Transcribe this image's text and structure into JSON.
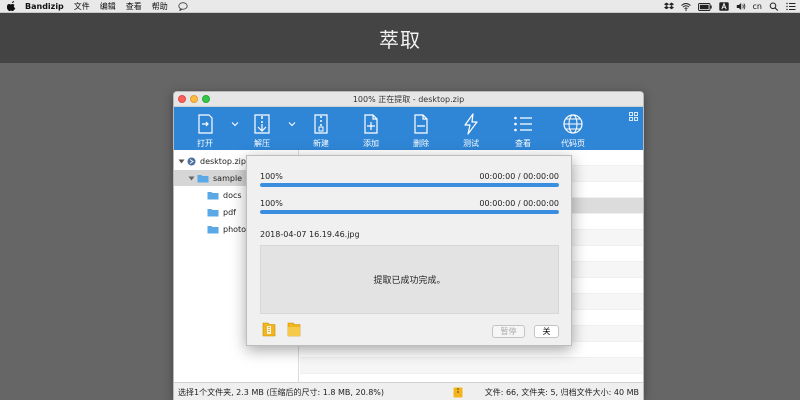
{
  "menubar": {
    "app": "Bandizip",
    "items": [
      "文件",
      "编辑",
      "查看",
      "帮助"
    ],
    "clock": "cn"
  },
  "header": {
    "title": "萃取"
  },
  "window": {
    "title": "100% 正在提取 - desktop.zip",
    "toolbar": [
      {
        "label": "打开",
        "icon": "open-icon"
      },
      {
        "label": "解压",
        "icon": "extract-icon"
      },
      {
        "label": "新建",
        "icon": "new-archive-icon"
      },
      {
        "label": "添加",
        "icon": "add-file-icon"
      },
      {
        "label": "删除",
        "icon": "delete-file-icon"
      },
      {
        "label": "测试",
        "icon": "test-lightning-icon"
      },
      {
        "label": "查看",
        "icon": "view-list-icon"
      },
      {
        "label": "代码页",
        "icon": "codepage-globe-icon"
      }
    ],
    "tree": {
      "root": "desktop.zip",
      "folder": "sample",
      "children": [
        "docs",
        "pdf",
        "photos"
      ]
    },
    "status": {
      "left": "选择1个文件夹, 2.3 MB (压缩后的尺寸: 1.8 MB, 20.8%)",
      "right": "文件: 66, 文件夹: 5, 归档文件大小: 40 MB"
    }
  },
  "dialog": {
    "progress": [
      {
        "percent_label": "100%",
        "time": "00:00:00 / 00:00:00",
        "fraction": 1.0
      },
      {
        "percent_label": "100%",
        "time": "00:00:00 / 00:00:00",
        "fraction": 1.0
      }
    ],
    "current_file": "2018-04-07 16.19.46.jpg",
    "message": "提取已成功完成。",
    "pause_label": "暂停",
    "close_label": "关"
  },
  "colors": {
    "toolbar": "#2f86d6",
    "progress": "#3a8ee0",
    "folder": "#5aa9e6"
  }
}
